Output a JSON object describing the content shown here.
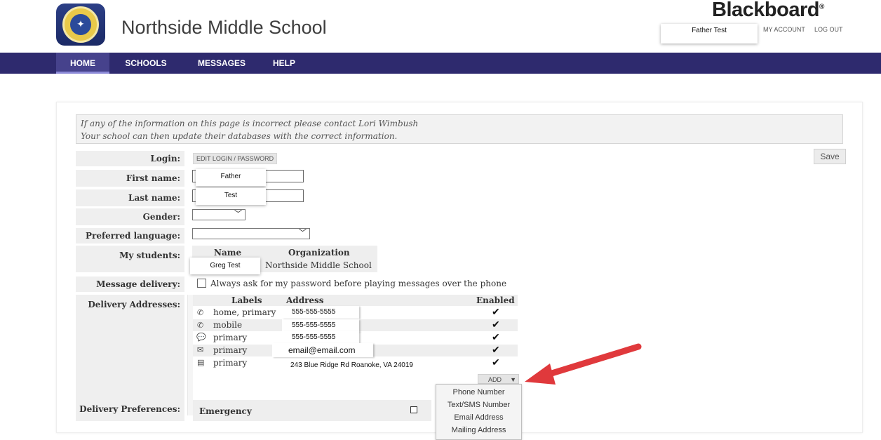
{
  "header": {
    "school_name": "Northside Middle School",
    "brand": "Blackboard",
    "brand_mark": "®",
    "user_name": "Father Test",
    "my_account": "MY ACCOUNT",
    "log_out": "LOG OUT"
  },
  "nav": {
    "items": [
      {
        "label": "HOME",
        "active": true
      },
      {
        "label": "SCHOOLS"
      },
      {
        "label": "MESSAGES"
      },
      {
        "label": "HELP"
      }
    ]
  },
  "notice": {
    "line1": "If any of the information on this page is incorrect please contact Lori Wimbush",
    "line2": "Your school can then update their databases with the correct information."
  },
  "form": {
    "save_label": "Save",
    "login_label": "Login:",
    "edit_login": "EDIT LOGIN / PASSWORD",
    "first_name_label": "First name:",
    "first_name_value": "Father",
    "last_name_label": "Last name:",
    "last_name_value": "Test",
    "gender_label": "Gender:",
    "language_label": "Preferred language:",
    "students_label": "My students:",
    "students_col_name": "Name",
    "students_col_org": "Organization",
    "student_name": "Greg Test",
    "student_org": "Northside Middle School",
    "message_delivery_label": "Message delivery:",
    "message_delivery_option": "Always ask for my password before playing messages over the phone",
    "delivery_addresses_label": "Delivery Addresses:",
    "addr_col_labels": "Labels",
    "addr_col_address": "Address",
    "addr_col_enabled": "Enabled",
    "addresses": [
      {
        "icon": "phone-icon",
        "glyph": "✆",
        "label": "home, primary",
        "address": "555-555-5555",
        "enabled": "✔"
      },
      {
        "icon": "phone-icon",
        "glyph": "✆",
        "label": "mobile",
        "address": "555-555-5555",
        "enabled": "✔"
      },
      {
        "icon": "sms-icon",
        "glyph": "💬",
        "label": "primary",
        "address": "555-555-5555",
        "enabled": "✔"
      },
      {
        "icon": "email-icon",
        "glyph": "✉",
        "label": "primary",
        "address": "email@email.com",
        "enabled": "✔"
      },
      {
        "icon": "mailing-address-icon",
        "glyph": "▤",
        "label": "primary",
        "address": "243 Blue Ridge Rd Roanoke, VA 24019",
        "enabled": "✔"
      }
    ],
    "add_button": "ADD",
    "add_menu": [
      "Phone Number",
      "Text/SMS Number",
      "Email Address",
      "Mailing Address"
    ],
    "delivery_prefs_label": "Delivery Preferences:",
    "emergency_label": "Emergency"
  },
  "colors": {
    "nav_bg": "#2e2a6e",
    "nav_active": "#46428c",
    "annotation_arrow": "#e0393c"
  }
}
